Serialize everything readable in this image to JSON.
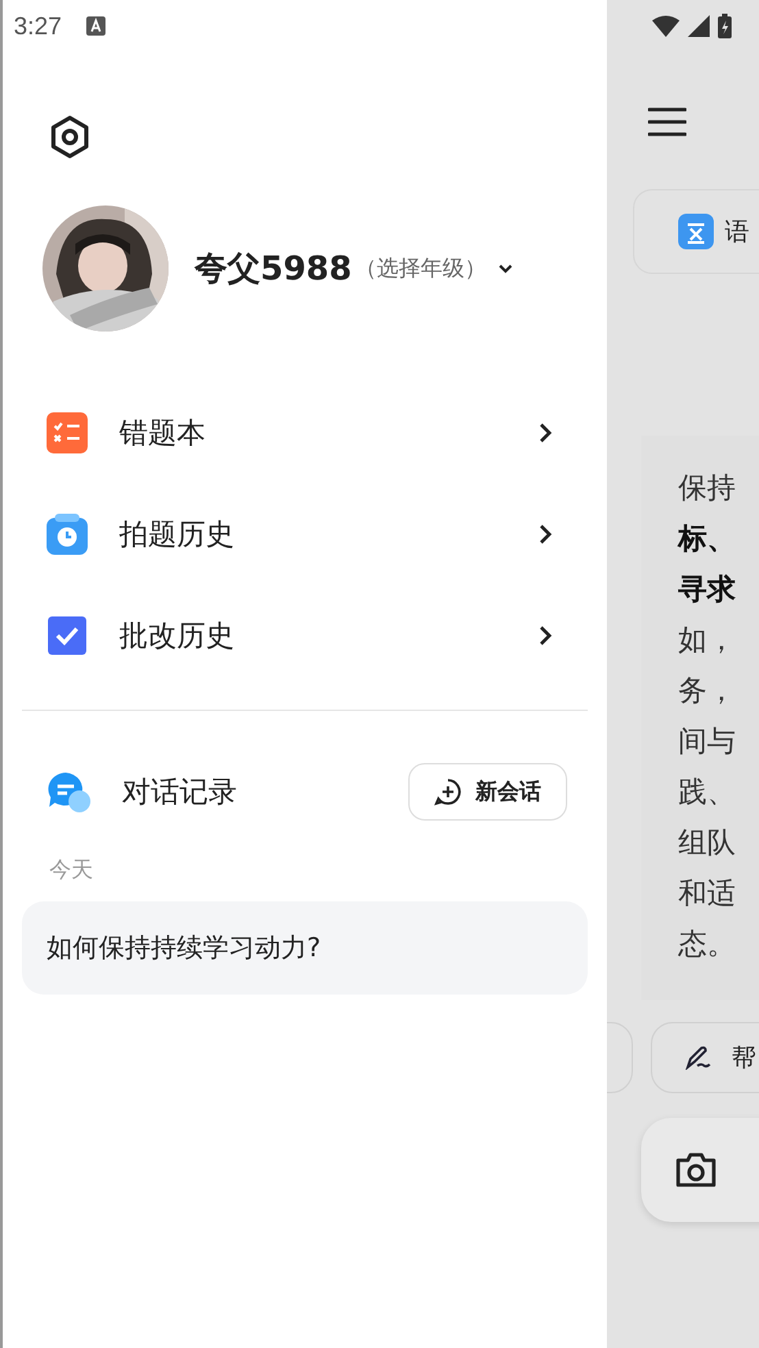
{
  "status_bar": {
    "time": "3:27"
  },
  "drawer": {
    "user": {
      "name": "夸父5988",
      "grade_hint": "（选择年级）"
    },
    "menu": [
      {
        "label": "错题本",
        "kind": "wrong"
      },
      {
        "label": "拍题历史"
      },
      {
        "label": "批改历史",
        "kind": "review"
      }
    ],
    "chat": {
      "label": "对话记录",
      "new_button": "新会话",
      "groups": [
        {
          "heading": "今天",
          "items": [
            "如何保持持续学习动力?"
          ]
        }
      ]
    }
  },
  "background": {
    "subject_chip": "语",
    "answer_lines": [
      {
        "text": "保持",
        "bold": false
      },
      {
        "text": "标、",
        "bold": true
      },
      {
        "text": "寻求",
        "bold": true
      },
      {
        "text": "如，",
        "bold": false
      },
      {
        "text": "务，",
        "bold": false
      },
      {
        "text": "间与",
        "bold": false
      },
      {
        "text": "践、",
        "bold": false
      },
      {
        "text": "组队",
        "bold": false
      },
      {
        "text": "和适",
        "bold": false
      },
      {
        "text": "态。",
        "bold": false
      }
    ],
    "action_chip": "帮"
  }
}
